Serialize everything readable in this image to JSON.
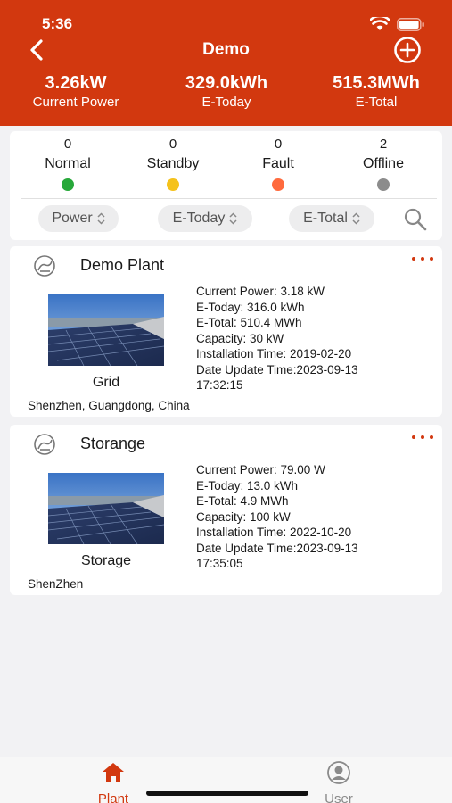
{
  "status_bar": {
    "time": "5:36"
  },
  "header": {
    "title": "Demo",
    "stats": [
      {
        "value": "3.26kW",
        "label": "Current Power"
      },
      {
        "value": "329.0kWh",
        "label": "E-Today"
      },
      {
        "value": "515.3MWh",
        "label": "E-Total"
      }
    ]
  },
  "status_summary": [
    {
      "count": "0",
      "name": "Normal",
      "color": "#27a83a"
    },
    {
      "count": "0",
      "name": "Standby",
      "color": "#f5c21b"
    },
    {
      "count": "0",
      "name": "Fault",
      "color": "#ff6a3d"
    },
    {
      "count": "2",
      "name": "Offline",
      "color": "#8c8c8c"
    }
  ],
  "sort_options": [
    "Power",
    "E-Today",
    "E-Total"
  ],
  "plants": [
    {
      "name": "Demo Plant",
      "type": "Grid",
      "details": [
        "Current Power: 3.18 kW",
        "E-Today: 316.0 kWh",
        "E-Total: 510.4 MWh",
        "Capacity: 30 kW",
        "Installation Time: 2019-02-20",
        "Date Update Time:2023-09-13",
        "17:32:15"
      ],
      "location": "Shenzhen, Guangdong, China"
    },
    {
      "name": "Storange",
      "type": "Storage",
      "details": [
        "Current Power: 79.00 W",
        "E-Today: 13.0 kWh",
        "E-Total: 4.9 MWh",
        "Capacity: 100 kW",
        "Installation Time: 2022-10-20",
        "Date Update Time:2023-09-13",
        "17:35:05"
      ],
      "location": "ShenZhen"
    }
  ],
  "tabbar": {
    "tabs": [
      {
        "label": "Plant",
        "active": true,
        "icon": "home-icon"
      },
      {
        "label": "User",
        "active": false,
        "icon": "user-icon"
      }
    ],
    "active_color": "#d2380f",
    "inactive_color": "#8a8a8a"
  },
  "brand_color": "#d2380f"
}
